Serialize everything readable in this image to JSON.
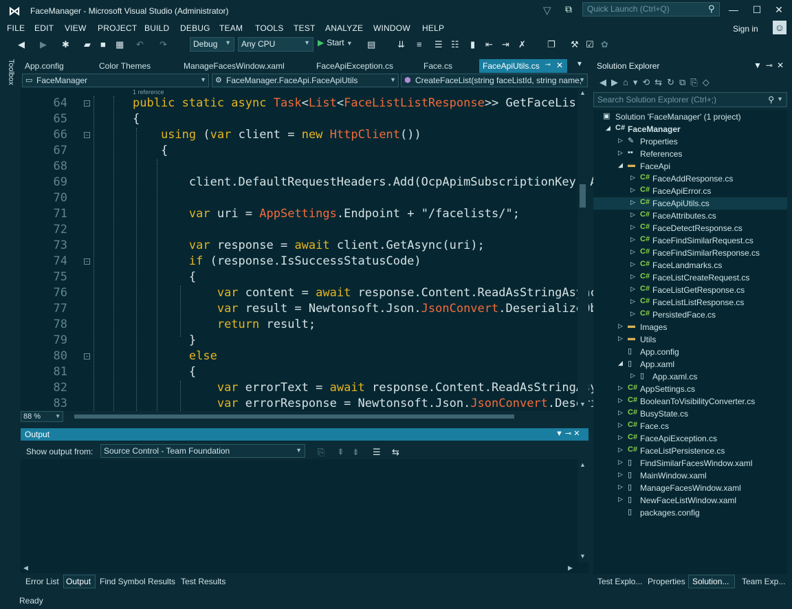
{
  "window": {
    "title": "FaceManager - Microsoft Visual Studio  (Administrator)",
    "quick_launch_placeholder": "Quick Launch (Ctrl+Q)"
  },
  "menu": [
    "FILE",
    "EDIT",
    "VIEW",
    "PROJECT",
    "BUILD",
    "DEBUG",
    "TEAM",
    "TOOLS",
    "TEST",
    "ANALYZE",
    "WINDOW",
    "HELP"
  ],
  "signin": "Sign in",
  "toolbar": {
    "config": "Debug",
    "platform": "Any CPU",
    "start": "Start"
  },
  "toolbox_label": "Toolbox",
  "tabs": [
    "App.config",
    "Color Themes",
    "ManageFacesWindow.xaml",
    "FaceApiException.cs",
    "Face.cs",
    "FaceApiUtils.cs"
  ],
  "nav": {
    "project": "FaceManager",
    "class": "FaceManager.FaceApi.FaceApiUtils",
    "member": "CreateFaceList(string faceListId, string name,"
  },
  "editor": {
    "reference_hint": "1 reference",
    "zoom": "88 %",
    "line_numbers": [
      "64",
      "65",
      "66",
      "67",
      "68",
      "69",
      "70",
      "71",
      "72",
      "73",
      "74",
      "75",
      "76",
      "77",
      "78",
      "79",
      "80",
      "81",
      "82",
      "83"
    ]
  },
  "output": {
    "title": "Output",
    "show_from_label": "Show output from:",
    "source": "Source Control - Team Foundation"
  },
  "bottom_tabs": [
    "Error List",
    "Output",
    "Find Symbol Results",
    "Test Results"
  ],
  "status": "Ready",
  "solution_explorer": {
    "title": "Solution Explorer",
    "search_placeholder": "Search Solution Explorer (Ctrl+;)",
    "tree": [
      {
        "label": "Solution 'FaceManager' (1 project)",
        "level": 0,
        "icon": "solution",
        "exp": ""
      },
      {
        "label": "FaceManager",
        "level": 1,
        "icon": "csproj",
        "exp": "open"
      },
      {
        "label": "Properties",
        "level": 2,
        "icon": "wrench",
        "exp": "closed"
      },
      {
        "label": "References",
        "level": 2,
        "icon": "refs",
        "exp": "closed"
      },
      {
        "label": "FaceApi",
        "level": 2,
        "icon": "folder-open",
        "exp": "open"
      },
      {
        "label": "FaceAddResponse.cs",
        "level": 3,
        "icon": "cs",
        "exp": "closed"
      },
      {
        "label": "FaceApiError.cs",
        "level": 3,
        "icon": "cs",
        "exp": "closed"
      },
      {
        "label": "FaceApiUtils.cs",
        "level": 3,
        "icon": "cs",
        "exp": "closed",
        "selected": true
      },
      {
        "label": "FaceAttributes.cs",
        "level": 3,
        "icon": "cs",
        "exp": "closed"
      },
      {
        "label": "FaceDetectResponse.cs",
        "level": 3,
        "icon": "cs",
        "exp": "closed"
      },
      {
        "label": "FaceFindSimilarRequest.cs",
        "level": 3,
        "icon": "cs",
        "exp": "closed"
      },
      {
        "label": "FaceFindSimilarResponse.cs",
        "level": 3,
        "icon": "cs",
        "exp": "closed"
      },
      {
        "label": "FaceLandmarks.cs",
        "level": 3,
        "icon": "cs",
        "exp": "closed"
      },
      {
        "label": "FaceListCreateRequest.cs",
        "level": 3,
        "icon": "cs",
        "exp": "closed"
      },
      {
        "label": "FaceListGetResponse.cs",
        "level": 3,
        "icon": "cs",
        "exp": "closed"
      },
      {
        "label": "FaceListListResponse.cs",
        "level": 3,
        "icon": "cs",
        "exp": "closed"
      },
      {
        "label": "PersistedFace.cs",
        "level": 3,
        "icon": "cs",
        "exp": "closed"
      },
      {
        "label": "Images",
        "level": 2,
        "icon": "folder",
        "exp": "closed"
      },
      {
        "label": "Utils",
        "level": 2,
        "icon": "folder",
        "exp": "closed"
      },
      {
        "label": "App.config",
        "level": 2,
        "icon": "file",
        "exp": ""
      },
      {
        "label": "App.xaml",
        "level": 2,
        "icon": "file",
        "exp": "open"
      },
      {
        "label": "App.xaml.cs",
        "level": 3,
        "icon": "file",
        "exp": "closed"
      },
      {
        "label": "AppSettings.cs",
        "level": 2,
        "icon": "cs",
        "exp": "closed"
      },
      {
        "label": "BooleanToVisibilityConverter.cs",
        "level": 2,
        "icon": "cs",
        "exp": "closed"
      },
      {
        "label": "BusyState.cs",
        "level": 2,
        "icon": "cs",
        "exp": "closed"
      },
      {
        "label": "Face.cs",
        "level": 2,
        "icon": "cs",
        "exp": "closed"
      },
      {
        "label": "FaceApiException.cs",
        "level": 2,
        "icon": "cs",
        "exp": "closed"
      },
      {
        "label": "FaceListPersistence.cs",
        "level": 2,
        "icon": "cs",
        "exp": "closed"
      },
      {
        "label": "FindSimilarFacesWindow.xaml",
        "level": 2,
        "icon": "file",
        "exp": "closed"
      },
      {
        "label": "MainWindow.xaml",
        "level": 2,
        "icon": "file",
        "exp": "closed"
      },
      {
        "label": "ManageFacesWindow.xaml",
        "level": 2,
        "icon": "file",
        "exp": "closed"
      },
      {
        "label": "NewFaceListWindow.xaml",
        "level": 2,
        "icon": "file",
        "exp": "closed"
      },
      {
        "label": "packages.config",
        "level": 2,
        "icon": "file",
        "exp": ""
      }
    ],
    "bottom_tabs": [
      "Test Explo...",
      "Properties",
      "Solution...",
      "Team Exp..."
    ]
  }
}
